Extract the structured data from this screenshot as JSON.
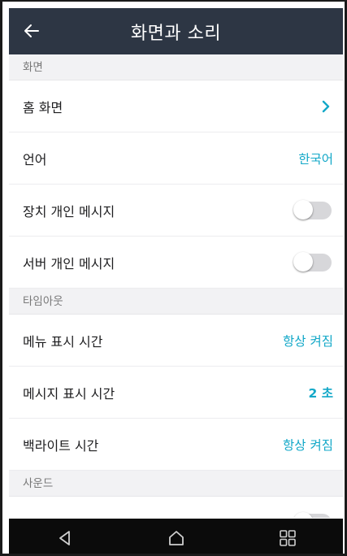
{
  "header": {
    "title": "화면과 소리",
    "back_icon": "arrow-left-icon"
  },
  "sections": {
    "screen": {
      "title": "화면",
      "rows": {
        "home": {
          "label": "홈 화면",
          "icon": "chevron-right-icon"
        },
        "language": {
          "label": "언어",
          "value": "한국어"
        },
        "device_messages": {
          "label": "장치 개인 메시지",
          "toggle": "off"
        },
        "server_messages": {
          "label": "서버 개인 메시지",
          "toggle": "off"
        }
      }
    },
    "timeout": {
      "title": "타임아웃",
      "rows": {
        "menu_display_time": {
          "label": "메뉴 표시 시간",
          "value": "항상 켜짐"
        },
        "message_display_time": {
          "label": "메시지 표시 시간",
          "value": "2 초"
        },
        "backlight_time": {
          "label": "백라이트 시간",
          "value": "항상 켜짐"
        }
      }
    },
    "sound": {
      "title": "사운드"
    }
  },
  "navbar": {
    "icons": [
      "back-triangle-icon",
      "home-icon",
      "recent-apps-icon"
    ]
  },
  "colors": {
    "appbar": "#2d3644",
    "accent": "#13a8c8",
    "section_bg": "#f2f2f4",
    "navbar": "#0b0b0b"
  }
}
